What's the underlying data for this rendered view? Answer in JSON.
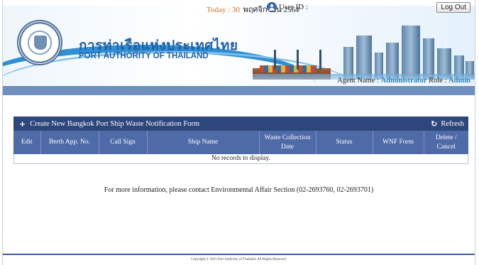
{
  "header": {
    "today_label": "Today : 30",
    "today_date": "พฤศจิกายน 2564",
    "user_id_label": "User ID :",
    "logout_label": "Log Out",
    "org_thai": "การท่าเรือแห่งประเทศไทย",
    "org_english": "PORT AUTHORITY OF THAILAND",
    "agent_label": "Agent Name :",
    "agent_value": "Administrator",
    "role_label": "Role :",
    "role_value": "Admin"
  },
  "grid": {
    "create_label": "Create New Bangkok Port Ship Waste Notification Form",
    "refresh_label": "Refresh",
    "columns": [
      "Edit",
      "Berth App. No.",
      "Call Sign",
      "Ship Name",
      "Waste Collection Date",
      "Status",
      "WNF Form",
      "Delete / Cancel"
    ],
    "empty_message": "No records to display."
  },
  "info_text": "For more information, please contact Environmental Affair Section (02-2693760, 02-2693701)",
  "copyright": "Copyright © 2021 Port Authority of Thailand. All Rights Reserved.",
  "colors": {
    "toolbar": "#2d467c",
    "header_row": "#4e6aa7",
    "navbar": "#6f8fbf",
    "brand_blue": "#1f5fa8"
  }
}
